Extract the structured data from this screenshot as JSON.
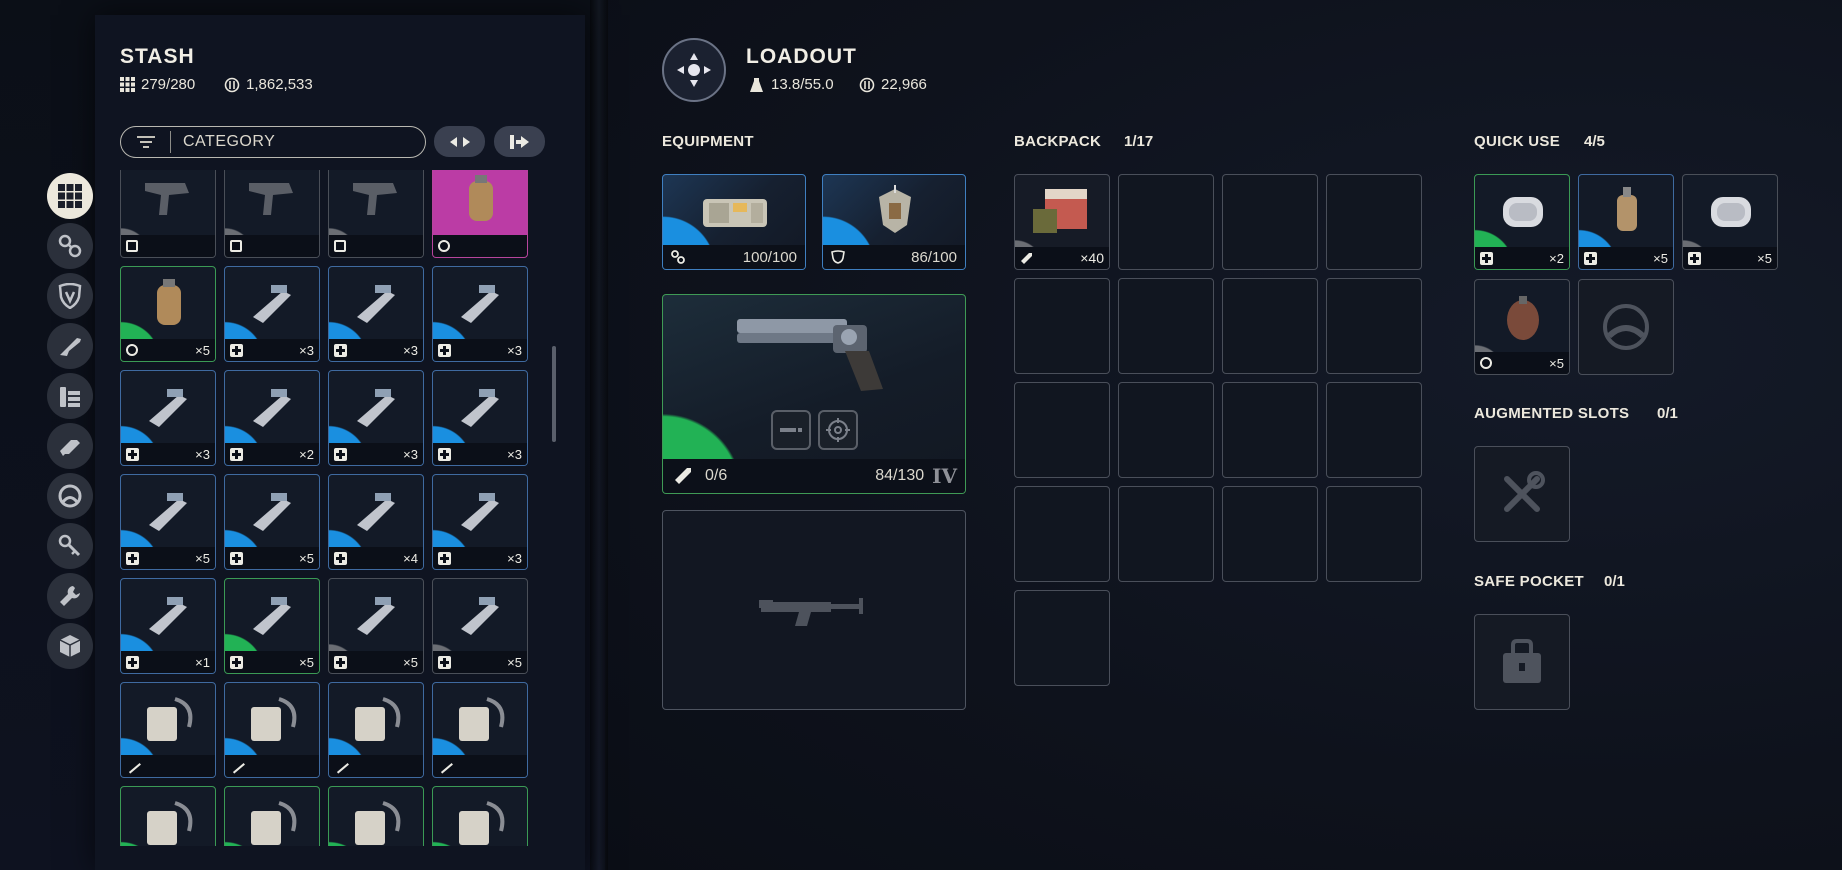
{
  "stash": {
    "title": "STASH",
    "capacity": "279/280",
    "value": "1,862,533",
    "filter_label": "CATEGORY",
    "categories": [
      "grid-icon",
      "attachments-icon",
      "shield-icon",
      "weapon-icon",
      "ammo-icon",
      "mods-icon",
      "augment-icon",
      "key-icon",
      "wrench-icon",
      "cube-icon"
    ],
    "items": [
      {
        "rarity": "grey",
        "qty": "",
        "type": "ammo"
      },
      {
        "rarity": "grey",
        "qty": "",
        "type": "ammo"
      },
      {
        "rarity": "grey",
        "qty": "",
        "type": "ammo"
      },
      {
        "rarity": "pink",
        "qty": "",
        "type": "grenade"
      },
      {
        "rarity": "green",
        "qty": "×5",
        "type": "grenade"
      },
      {
        "rarity": "blue",
        "qty": "×3",
        "type": "med"
      },
      {
        "rarity": "blue",
        "qty": "×3",
        "type": "med"
      },
      {
        "rarity": "blue",
        "qty": "×3",
        "type": "med"
      },
      {
        "rarity": "blue",
        "qty": "×3",
        "type": "med"
      },
      {
        "rarity": "blue",
        "qty": "×2",
        "type": "med"
      },
      {
        "rarity": "blue",
        "qty": "×3",
        "type": "med"
      },
      {
        "rarity": "blue",
        "qty": "×3",
        "type": "med"
      },
      {
        "rarity": "blue",
        "qty": "×5",
        "type": "med"
      },
      {
        "rarity": "blue",
        "qty": "×5",
        "type": "med"
      },
      {
        "rarity": "blue",
        "qty": "×4",
        "type": "med"
      },
      {
        "rarity": "blue",
        "qty": "×3",
        "type": "med"
      },
      {
        "rarity": "blue",
        "qty": "×1",
        "type": "med"
      },
      {
        "rarity": "green",
        "qty": "×5",
        "type": "med"
      },
      {
        "rarity": "grey",
        "qty": "×5",
        "type": "med"
      },
      {
        "rarity": "grey",
        "qty": "×5",
        "type": "med"
      },
      {
        "rarity": "blue",
        "qty": "",
        "type": "key"
      },
      {
        "rarity": "blue",
        "qty": "",
        "type": "key"
      },
      {
        "rarity": "blue",
        "qty": "",
        "type": "key"
      },
      {
        "rarity": "blue",
        "qty": "",
        "type": "key"
      },
      {
        "rarity": "green",
        "qty": "",
        "type": "key"
      },
      {
        "rarity": "green",
        "qty": "",
        "type": "key"
      },
      {
        "rarity": "green",
        "qty": "",
        "type": "key"
      },
      {
        "rarity": "green",
        "qty": "",
        "type": "key"
      }
    ]
  },
  "loadout": {
    "title": "LOADOUT",
    "weight": "13.8/55.0",
    "value": "22,966"
  },
  "equipment": {
    "label": "EQUIPMENT",
    "augment": {
      "durability": "100/100"
    },
    "shield": {
      "durability": "86/100"
    },
    "weapon1": {
      "ammo": "0/6",
      "durability": "84/130",
      "tier": "IV"
    }
  },
  "backpack": {
    "label": "BACKPACK",
    "count": "1/17",
    "item_qty": "×40"
  },
  "quick_use": {
    "label": "QUICK USE",
    "count": "4/5",
    "items": [
      {
        "rarity": "green",
        "qty": "×2"
      },
      {
        "rarity": "blue",
        "qty": "×5"
      },
      {
        "rarity": "grey",
        "qty": "×5"
      },
      {
        "rarity": "grey",
        "qty": "×5"
      }
    ]
  },
  "augmented": {
    "label": "AUGMENTED SLOTS",
    "count": "0/1"
  },
  "safe_pocket": {
    "label": "SAFE POCKET",
    "count": "0/1"
  },
  "colors": {
    "common": "#6b6e74",
    "uncommon": "#22b255",
    "rare": "#1a8fe0",
    "epic": "#bb3ca5"
  }
}
